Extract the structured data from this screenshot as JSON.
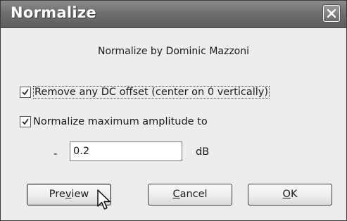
{
  "dialog": {
    "title": "Normalize",
    "subtitle": "Normalize by Dominic Mazzoni"
  },
  "options": {
    "remove_dc": {
      "label": "Remove any DC offset (center on 0 vertically)",
      "checked": true
    },
    "normalize_amp": {
      "label": "Normalize maximum amplitude to",
      "checked": true
    }
  },
  "amplitude": {
    "sign": "-",
    "value": "0.2",
    "unit": "dB"
  },
  "buttons": {
    "preview": {
      "pre": "Pre",
      "mnemonic": "v",
      "post": "iew"
    },
    "cancel": {
      "pre": "",
      "mnemonic": "C",
      "post": "ancel"
    },
    "ok": {
      "pre": "",
      "mnemonic": "O",
      "post": "K"
    }
  },
  "icons": {
    "close": "close-icon",
    "check": "checkmark-icon",
    "cursor": "mouse-pointer-icon"
  }
}
